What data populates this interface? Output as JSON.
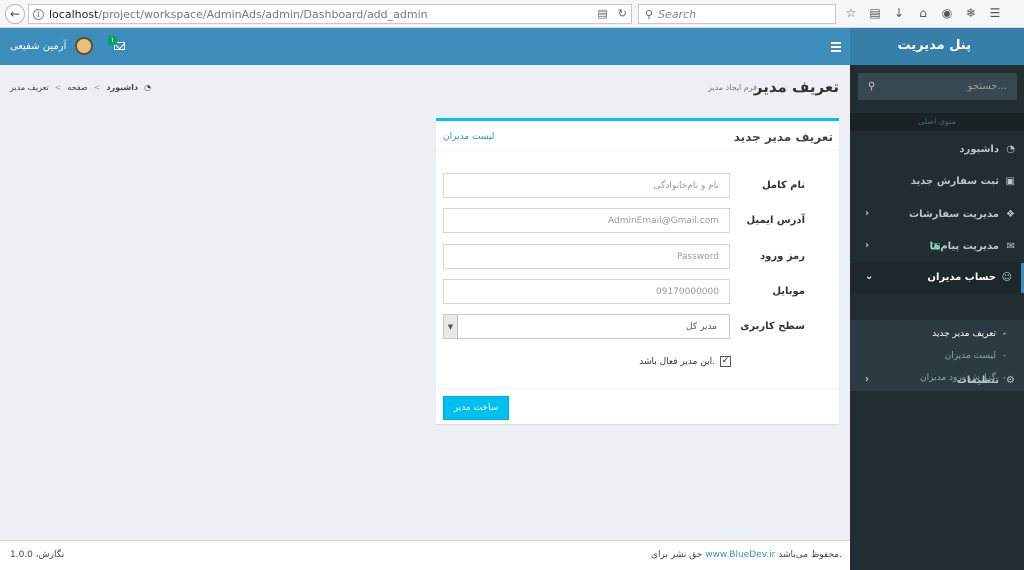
{
  "browser": {
    "url_host": "localhost",
    "url_path": "/project/workspace/AdminAds/admin/Dashboard/add_admin",
    "search_placeholder": "Search"
  },
  "header": {
    "user_name": "آرمین شفیعی",
    "mail_badge": "۱"
  },
  "sidebar": {
    "brand": "پنل مدیریت",
    "search_placeholder": "جستجو...",
    "section_header": "منوی اصلی",
    "items": [
      {
        "label": "داشبورد",
        "icon": "dashboard-icon"
      },
      {
        "label": "ثبت سفارش جدید",
        "icon": "cart-icon"
      },
      {
        "label": "مدیریت سفارشات",
        "icon": "cubes-icon"
      },
      {
        "label": "مدیریت پیام‌ها",
        "icon": "envelope-icon"
      },
      {
        "label": "حساب مدیران",
        "icon": "user-circle-icon"
      },
      {
        "label": "تنظیمات",
        "icon": "gear-icon"
      }
    ],
    "submenu": [
      {
        "label": "تعریف مدیر جدید",
        "active": true
      },
      {
        "label": "لیست مدیران",
        "active": false
      },
      {
        "label": "گزارش ورود مدیران",
        "active": false
      }
    ]
  },
  "content": {
    "title": "تعریف مدیر",
    "subtitle": "فرم ایجاد مدیر",
    "breadcrumb": [
      "داشبورد",
      "صفحه",
      "تعریف مدیر"
    ]
  },
  "form": {
    "box_title": "تعریف مدیر جدید",
    "list_link": "لیست مدیران",
    "fields": [
      {
        "label": "نام کامل",
        "placeholder": "نام و نام‌خانوادگی"
      },
      {
        "label": "آدرس ایمیل",
        "placeholder": "AdminEmail@Gmail.com"
      },
      {
        "label": "رمز ورود",
        "placeholder": "Password"
      },
      {
        "label": "موبایل",
        "placeholder": "09170000000"
      },
      {
        "label": "سطح کاربری",
        "value": "مدیر کل"
      }
    ],
    "active_checkbox_label": "این مدیر فعال باشد.",
    "active_checked": true,
    "submit_label": "ساخت مدیر"
  },
  "footer": {
    "copyright_prefix": "حق نشر برای",
    "copyright_link": "www.BlueDev.ir",
    "copyright_suffix": "محفوظ می‌باشد.",
    "version": "نگارش، 1.0.0"
  }
}
